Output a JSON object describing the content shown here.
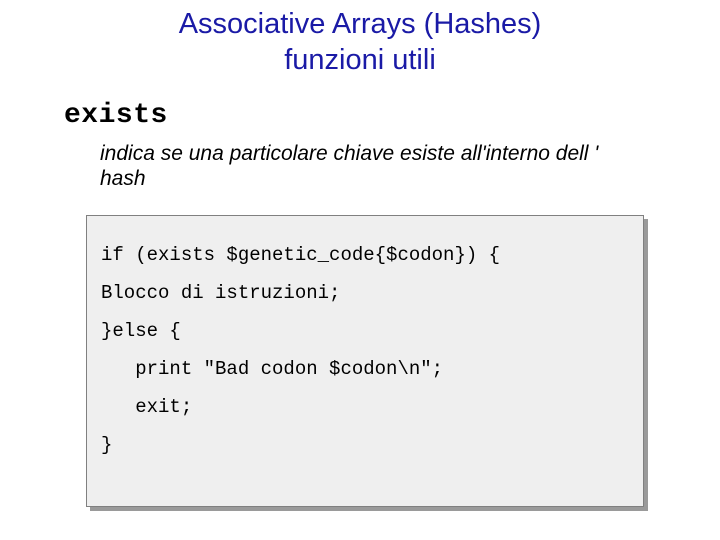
{
  "title_line1": "Associative Arrays (Hashes)",
  "title_line2": "funzioni utili",
  "keyword": "exists",
  "description": "indica se una particolare chiave  esiste all'interno dell ' hash",
  "code": {
    "l1": "if (exists $genetic_code{$codon}) {",
    "l2": "Blocco di istruzioni;",
    "l3": "}else {",
    "l4": "   print \"Bad codon $codon\\n\";",
    "l5": "   exit;",
    "l6": "}"
  }
}
